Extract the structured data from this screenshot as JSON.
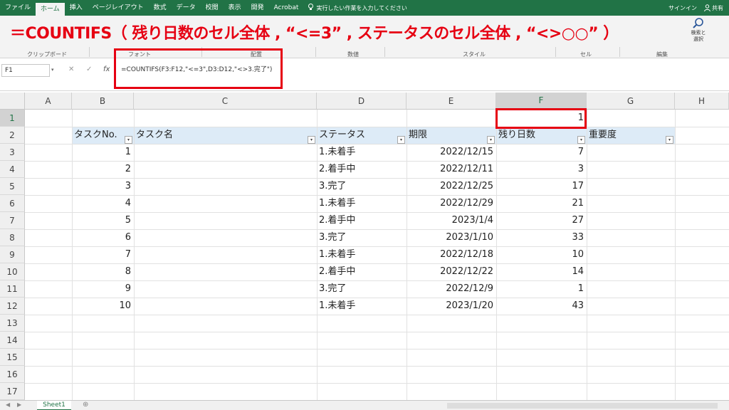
{
  "ribbon": {
    "tabs": [
      "ファイル",
      "ホーム",
      "挿入",
      "ページレイアウト",
      "数式",
      "データ",
      "校閲",
      "表示",
      "開発",
      "Acrobat"
    ],
    "active_tab": "ホーム",
    "tell_me": "実行したい作業を入力してください",
    "signin": "サインイン",
    "share": "共有",
    "groups": [
      "クリップボード",
      "フォント",
      "配置",
      "数値",
      "スタイル",
      "セル",
      "編集"
    ],
    "search_label_1": "検索と",
    "search_label_2": "選択"
  },
  "banner": "＝COUNTIFS（ 残り日数のセル全体 , “<=3” , ステータスのセル全体 , “<>○○” ）",
  "formula_bar": {
    "name_box": "F1",
    "cancel": "✕",
    "enter": "✓",
    "fx": "fx",
    "formula": "=COUNTIFS(F3:F12,\"<=3\",D3:D12,\"<>3.完了\")"
  },
  "grid": {
    "columns": [
      "A",
      "B",
      "C",
      "D",
      "E",
      "F",
      "G",
      "H"
    ],
    "rows": [
      "1",
      "2",
      "3",
      "4",
      "5",
      "6",
      "7",
      "8",
      "9",
      "10",
      "11",
      "12",
      "13",
      "14",
      "15",
      "16",
      "17"
    ],
    "f1_value": "1",
    "headers": {
      "task_no": "タスクNo.",
      "task_name": "タスク名",
      "status": "ステータス",
      "due": "期限",
      "remaining": "残り日数",
      "priority": "重要度"
    },
    "records": [
      {
        "no": "1",
        "status": "1.未着手",
        "due": "2022/12/15",
        "remaining": "7"
      },
      {
        "no": "2",
        "status": "2.着手中",
        "due": "2022/12/11",
        "remaining": "3"
      },
      {
        "no": "3",
        "status": "3.完了",
        "due": "2022/12/25",
        "remaining": "17"
      },
      {
        "no": "4",
        "status": "1.未着手",
        "due": "2022/12/29",
        "remaining": "21"
      },
      {
        "no": "5",
        "status": "2.着手中",
        "due": "2023/1/4",
        "remaining": "27"
      },
      {
        "no": "6",
        "status": "3.完了",
        "due": "2023/1/10",
        "remaining": "33"
      },
      {
        "no": "7",
        "status": "1.未着手",
        "due": "2022/12/18",
        "remaining": "10"
      },
      {
        "no": "8",
        "status": "2.着手中",
        "due": "2022/12/22",
        "remaining": "14"
      },
      {
        "no": "9",
        "status": "3.完了",
        "due": "2022/12/9",
        "remaining": "1"
      },
      {
        "no": "10",
        "status": "1.未着手",
        "due": "2023/1/20",
        "remaining": "43"
      }
    ]
  },
  "sheet": {
    "tab": "Sheet1",
    "add": "⊕"
  },
  "colors": {
    "excel_green": "#217346",
    "highlight_red": "#e60012",
    "table_header_fill": "#ddebf7"
  }
}
